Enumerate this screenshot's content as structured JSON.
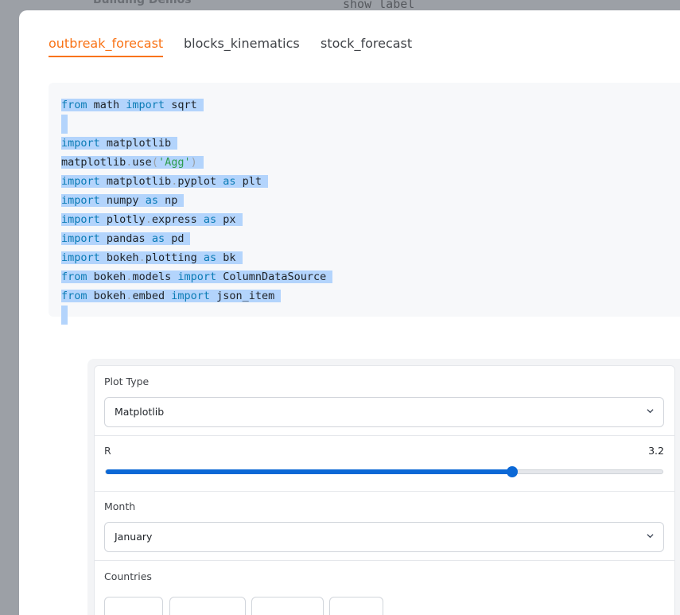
{
  "backdrop": {
    "left_text": "Building Demos",
    "right_text": "show_label"
  },
  "tabs": [
    {
      "label": "outbreak_forecast",
      "active": true
    },
    {
      "label": "blocks_kinematics",
      "active": false
    },
    {
      "label": "stock_forecast",
      "active": false
    }
  ],
  "code": {
    "language": "python",
    "lines": [
      "from math import sqrt",
      "",
      "import matplotlib",
      "matplotlib.use('Agg')",
      "import matplotlib.pyplot as plt",
      "import numpy as np",
      "import plotly.express as px",
      "import pandas as pd",
      "import bokeh.plotting as bk",
      "from bokeh.models import ColumnDataSource",
      "from bokeh.embed import json_item"
    ]
  },
  "controls": {
    "plot_type": {
      "label": "Plot Type",
      "value": "Matplotlib"
    },
    "r": {
      "label": "R",
      "value": "3.2",
      "fraction": 0.73
    },
    "month": {
      "label": "Month",
      "value": "January"
    },
    "countries": {
      "label": "Countries"
    }
  },
  "colors": {
    "accent": "#f97316",
    "slider": "#0b68d6",
    "keyword": "#0a7bb5",
    "string": "#2e9d4e",
    "selection": "#b3d4fc"
  }
}
